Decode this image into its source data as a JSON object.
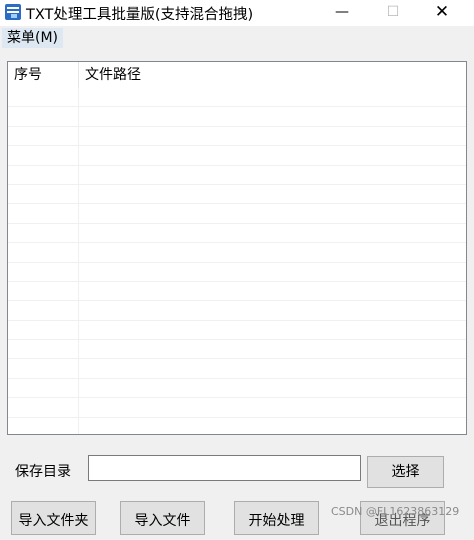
{
  "window": {
    "title": "TXT处理工具批量版(支持混合拖拽)",
    "minimize_glyph": "—",
    "maximize_glyph": "☐",
    "close_glyph": "✕"
  },
  "menu": {
    "items": [
      {
        "label": "菜单(M)"
      }
    ]
  },
  "list": {
    "columns": [
      "序号",
      "文件路径"
    ],
    "rows": []
  },
  "save": {
    "label": "保存目录",
    "value": "",
    "select_button": "选择"
  },
  "buttons": {
    "import_folder": "导入文件夹",
    "import_file": "导入文件",
    "start": "开始处理",
    "exit": "退出程序"
  },
  "watermark": "CSDN @FL1623863129",
  "icons": {
    "app": "app-window-icon",
    "minimize": "minimize-icon",
    "maximize": "maximize-icon",
    "close": "close-icon"
  }
}
